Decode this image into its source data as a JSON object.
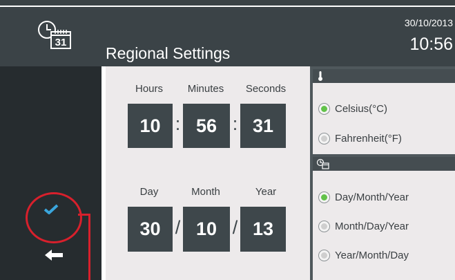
{
  "header": {
    "title": "Regional Settings",
    "date": "30/10/2013",
    "time": "10:56",
    "calendar_day": "31",
    "icon": "clock-calendar-icon"
  },
  "sidebar": {
    "confirm_icon": "checkmark-icon",
    "back_icon": "back-arrow-icon"
  },
  "time_setting": {
    "labels": {
      "hours": "Hours",
      "minutes": "Minutes",
      "seconds": "Seconds"
    },
    "values": {
      "hours": "10",
      "minutes": "56",
      "seconds": "31"
    },
    "separator": ":"
  },
  "date_setting": {
    "labels": {
      "day": "Day",
      "month": "Month",
      "year": "Year"
    },
    "values": {
      "day": "30",
      "month": "10",
      "year": "13"
    },
    "separator": "/"
  },
  "temperature_panel": {
    "icon": "thermometer-icon",
    "options": [
      {
        "label": "Celsius(°C)",
        "selected": true
      },
      {
        "label": "Fahrenheit(°F)",
        "selected": false
      }
    ]
  },
  "date_format_panel": {
    "icon": "clock-calendar-icon",
    "options": [
      {
        "label": "Day/Month/Year",
        "selected": true
      },
      {
        "label": "Month/Day/Year",
        "selected": false
      },
      {
        "label": "Year/Month/Day",
        "selected": false
      }
    ]
  },
  "colors": {
    "header_bg": "#3b4347",
    "sidebar_bg": "#262c2f",
    "panel_bg": "#edeaeb",
    "value_box": "#3e474b",
    "checkmark": "#3aa6dd",
    "highlight": "#d8202c",
    "radio_on": "#62c24a"
  }
}
